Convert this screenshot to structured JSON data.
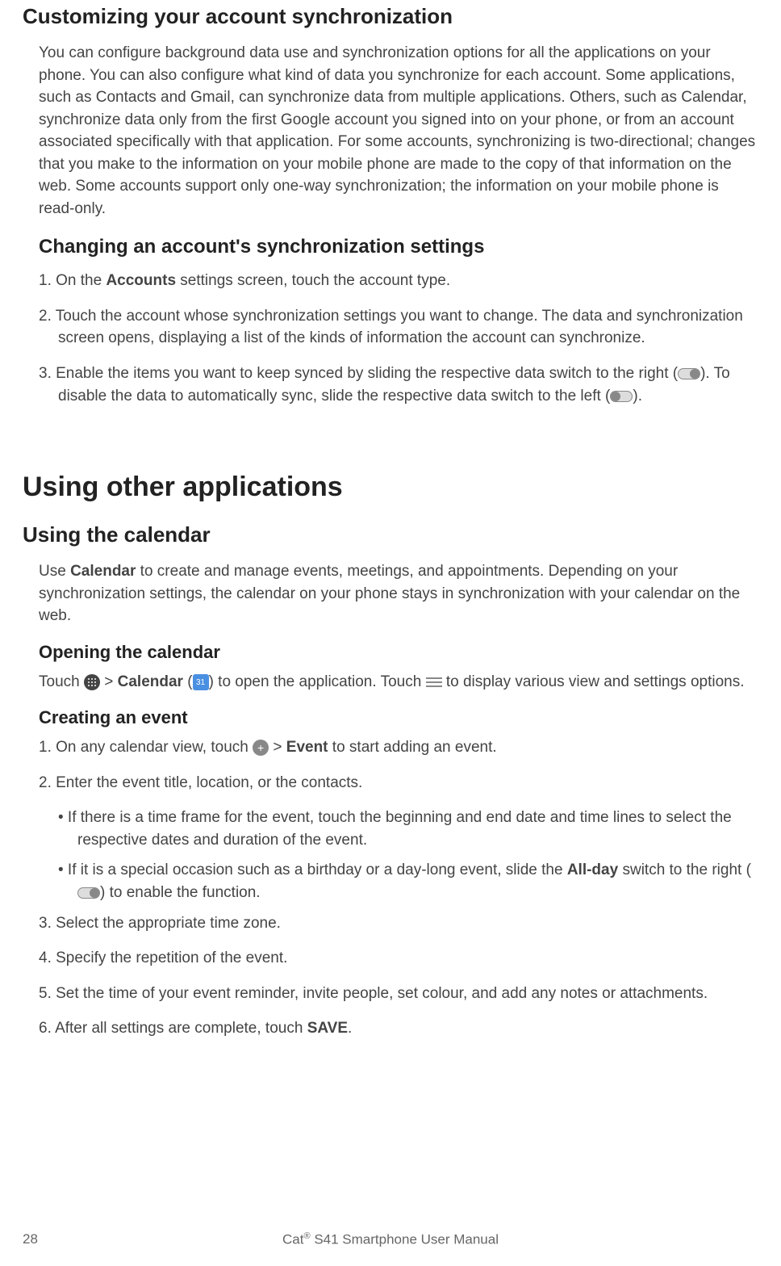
{
  "section1": {
    "title": "Customizing your account synchronization",
    "intro": "You can configure background data use and synchronization options for all the applications on your phone. You can also configure what kind of data you synchronize for each account. Some applications, such as Contacts and Gmail, can synchronize data from multiple applications. Others, such as Calendar, synchronize data only from the first Google account you signed into on your phone, or from an account associated specifically with that application. For some accounts, synchronizing is two-directional; changes that you make to the information on your mobile phone are made to the copy of that information on the web. Some accounts support only one-way synchronization; the information on your mobile phone is read-only.",
    "sub1_title": "Changing an account's synchronization settings",
    "step1_pre": "1. On the ",
    "step1_bold": "Accounts",
    "step1_post": " settings screen, touch the account type.",
    "step2": "2. Touch the account whose synchronization settings you want to change. The data and synchronization screen opens, displaying a list of the kinds of information the account can synchronize.",
    "step3_a": "3. Enable the items you want to keep synced by sliding the respective data switch to the right (",
    "step3_b": "). To disable the data to automatically sync, slide the respective data switch to the left (",
    "step3_c": ")."
  },
  "section2": {
    "title": "Using other applications",
    "sub1_title": "Using the calendar",
    "intro_pre": "Use ",
    "intro_bold": "Calendar",
    "intro_post": " to create and manage events, meetings, and appointments. Depending on your synchronization settings, the calendar on your phone stays in synchronization with your calendar on the web.",
    "opening_title": "Opening the calendar",
    "open_a": "Touch ",
    "open_b": " > ",
    "open_bold": "Calendar",
    "open_c": " (",
    "cal_num": "31",
    "open_d": ") to open the application. Touch ",
    "open_e": " to display various view and settings options.",
    "creating_title": "Creating an event",
    "c_step1_a": "1. On any calendar view, touch ",
    "c_step1_b": " > ",
    "c_step1_bold": "Event",
    "c_step1_c": " to start adding an event.",
    "c_step2": "2. Enter the event title, location, or the contacts.",
    "c_bullet1": "•  If there is a time frame for the event, touch the beginning and end date and time lines to select the respective dates and duration of the event.",
    "c_bullet2_a": "•  If it is a special occasion such as a birthday or a day-long event, slide the ",
    "c_bullet2_bold": "All-day",
    "c_bullet2_b": " switch to the right (",
    "c_bullet2_c": ") to enable the function.",
    "c_step3": "3. Select the appropriate time zone.",
    "c_step4": "4. Specify the repetition of the event.",
    "c_step5": "5. Set the time of your event reminder, invite people, set colour, and add any notes or attachments.",
    "c_step6_a": "6. After all settings are complete, touch ",
    "c_step6_bold": "SAVE",
    "c_step6_b": "."
  },
  "footer": {
    "page": "28",
    "title_a": "Cat",
    "title_b": " S41 Smartphone User Manual",
    "reg": "®"
  }
}
